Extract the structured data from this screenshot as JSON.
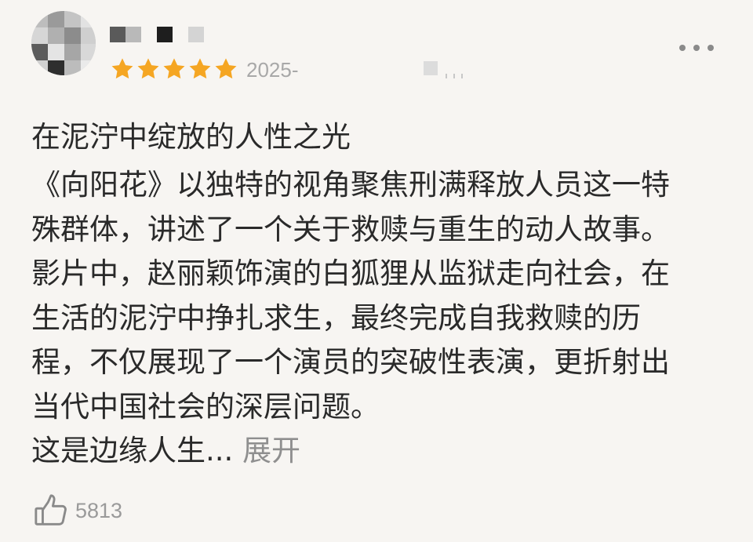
{
  "review": {
    "rating": 5,
    "date": "2025-",
    "title": "在泥泞中绽放的人性之光",
    "body_lines": [
      "《向阳花》以独特的视角聚焦刑满释放人员这一特",
      "殊群体，讲述了一个关于救赎与重生的动人故事。",
      "影片中，赵丽颖饰演的白狐狸从监狱走向社会，在",
      "生活的泥泞中挣扎求生，最终完成自我救赎的历",
      "程，不仅展现了一个演员的突破性表演，更折射出",
      "当代中国社会的深层问题。"
    ],
    "last_line": "这是边缘人生...",
    "expand_label": "展开",
    "like_count": "5813"
  },
  "colors": {
    "star": "#f5a623",
    "background": "#f7f5f2",
    "text": "#2a2a2a",
    "muted": "#8f8f8f"
  },
  "icons": {
    "more": "more-icon",
    "like": "thumbs-up-icon",
    "star": "star-icon"
  }
}
